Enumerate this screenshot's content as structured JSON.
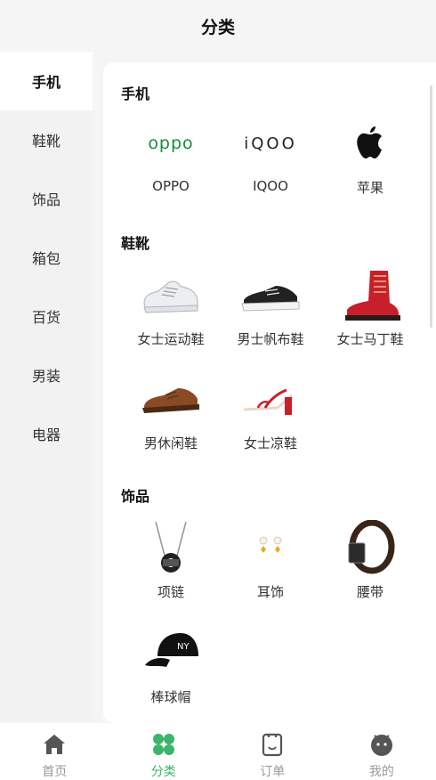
{
  "header": {
    "title": "分类"
  },
  "sidebar": {
    "items": [
      {
        "label": "手机",
        "active": true
      },
      {
        "label": "鞋靴",
        "active": false
      },
      {
        "label": "饰品",
        "active": false
      },
      {
        "label": "箱包",
        "active": false
      },
      {
        "label": "百货",
        "active": false
      },
      {
        "label": "男装",
        "active": false
      },
      {
        "label": "电器",
        "active": false
      }
    ]
  },
  "sections": [
    {
      "title": "手机",
      "items": [
        {
          "label": "OPPO",
          "logo_text": "oppo",
          "icon": "oppo-logo"
        },
        {
          "label": "IQOO",
          "logo_text": "iQOO",
          "icon": "iqoo-logo"
        },
        {
          "label": "苹果",
          "icon": "apple-logo"
        }
      ]
    },
    {
      "title": "鞋靴",
      "items": [
        {
          "label": "女士运动鞋",
          "icon": "sneaker-image"
        },
        {
          "label": "男士帆布鞋",
          "icon": "canvas-shoe-image"
        },
        {
          "label": "女士马丁鞋",
          "icon": "martin-boot-image"
        },
        {
          "label": "男休闲鞋",
          "icon": "casual-shoe-image"
        },
        {
          "label": "女士凉鞋",
          "icon": "sandal-image"
        }
      ]
    },
    {
      "title": "饰品",
      "items": [
        {
          "label": "项链",
          "icon": "necklace-image"
        },
        {
          "label": "耳饰",
          "icon": "earrings-image"
        },
        {
          "label": "腰带",
          "icon": "belt-image"
        },
        {
          "label": "棒球帽",
          "icon": "baseball-cap-image"
        }
      ]
    }
  ],
  "tabbar": {
    "items": [
      {
        "label": "首页",
        "icon": "home-icon",
        "active": false
      },
      {
        "label": "分类",
        "icon": "category-icon",
        "active": true
      },
      {
        "label": "订单",
        "icon": "order-icon",
        "active": false
      },
      {
        "label": "我的",
        "icon": "profile-icon",
        "active": false
      }
    ]
  },
  "colors": {
    "accent": "#3cb46c",
    "oppo_green": "#1a8a3c",
    "inactive": "#999999"
  }
}
